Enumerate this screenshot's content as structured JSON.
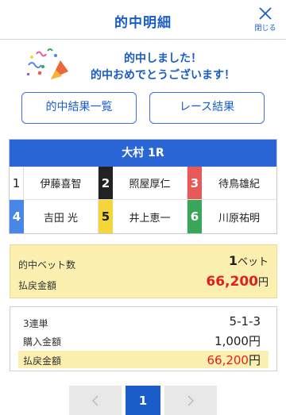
{
  "header": {
    "title": "的中明細",
    "close_label": "閉じる"
  },
  "congrats": {
    "line1": "的中しました！",
    "line2": "的中おめでとうございます！"
  },
  "buttons": {
    "hit_list": "的中結果一覧",
    "race_result": "レース結果"
  },
  "race": {
    "title": "大村 1R",
    "racers": [
      {
        "num": "1",
        "name": "伊藤喜智"
      },
      {
        "num": "2",
        "name": "照屋厚仁"
      },
      {
        "num": "3",
        "name": "待鳥雄紀"
      },
      {
        "num": "4",
        "name": "吉田 光"
      },
      {
        "num": "5",
        "name": "井上恵一"
      },
      {
        "num": "6",
        "name": "川原祐明"
      }
    ]
  },
  "summary": {
    "hit_bets_label": "的中ベット数",
    "hit_bets_value": "1",
    "hit_bets_unit": "ベット",
    "payout_label": "払戻金額",
    "payout_value": "66,200",
    "payout_unit": "円"
  },
  "detail": {
    "bet_type": "3連単",
    "combination": "5-1-3",
    "purchase_label": "購入金額",
    "purchase_value": "1,000",
    "purchase_unit": "円",
    "payout_label": "払戻金額",
    "payout_value": "66,200",
    "payout_unit": "円"
  },
  "pager": {
    "current": "1"
  },
  "colors": {
    "accent": "#1a5cc8",
    "payout": "#e02020",
    "highlight": "#fbf0b0"
  }
}
